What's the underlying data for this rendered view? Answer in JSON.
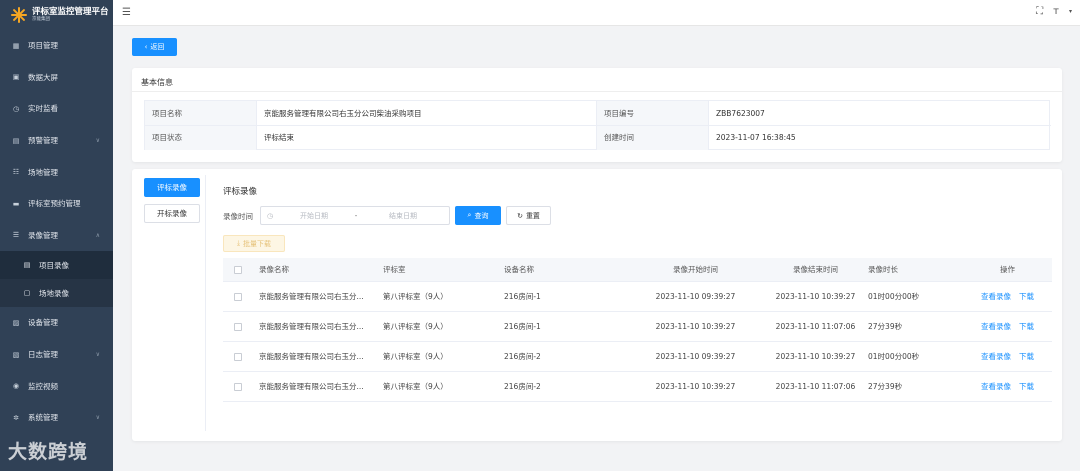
{
  "app": {
    "title": "评标室监控管理平台",
    "subtitle": "京能集团"
  },
  "sidebar": {
    "items": [
      {
        "label": "项目管理",
        "icon": "grid-icon",
        "has_children": false
      },
      {
        "label": "数据大屏",
        "icon": "screen-icon",
        "has_children": false
      },
      {
        "label": "实时监看",
        "icon": "clock-icon",
        "has_children": false
      },
      {
        "label": "预警管理",
        "icon": "alert-icon",
        "has_children": true
      },
      {
        "label": "场地管理",
        "icon": "venue-icon",
        "has_children": false
      },
      {
        "label": "评标室预约管理",
        "icon": "calendar-icon",
        "has_children": false
      },
      {
        "label": "录像管理",
        "icon": "video-icon",
        "has_children": true,
        "expanded": true
      }
    ],
    "subitems": [
      {
        "label": "项目录像",
        "icon": "file-icon",
        "active": true
      },
      {
        "label": "场地录像",
        "icon": "file-icon",
        "active": false
      }
    ],
    "items_after": [
      {
        "label": "设备管理",
        "icon": "device-icon",
        "has_children": false
      },
      {
        "label": "日志管理",
        "icon": "log-icon",
        "has_children": true
      },
      {
        "label": "监控视频",
        "icon": "eye-icon",
        "has_children": false
      },
      {
        "label": "系统管理",
        "icon": "gear-icon",
        "has_children": true
      }
    ]
  },
  "toolbar": {
    "back_label": "返回"
  },
  "basic_info": {
    "title": "基本信息",
    "project_name_label": "项目名称",
    "project_name": "京能服务管理有限公司右玉分公司柴油采购项目",
    "project_no_label": "项目编号",
    "project_no": "ZBB7623007",
    "project_status_label": "项目状态",
    "project_status": "评标结束",
    "created_label": "创建时间",
    "created": "2023-11-07 16:38:45"
  },
  "recordings": {
    "tabs": [
      "评标录像",
      "开标录像"
    ],
    "active_tab": 0,
    "title": "评标录像",
    "filter_label": "录像时间",
    "start_placeholder": "开始日期",
    "range_separator": "-",
    "end_placeholder": "结束日期",
    "search_label": "查询",
    "reset_label": "重置",
    "batch_download_label": "批量下载",
    "columns": [
      "录像名称",
      "评标室",
      "设备名称",
      "录像开始时间",
      "录像结束时间",
      "录像时长",
      "操作"
    ],
    "view_label": "查看录像",
    "download_label": "下载",
    "rows": [
      {
        "name": "京能服务管理有限公司右玉分...",
        "room": "第八评标室（9人）",
        "device": "216房间-1",
        "start": "2023-11-10 09:39:27",
        "end": "2023-11-10 10:39:27",
        "duration": "01时00分00秒"
      },
      {
        "name": "京能服务管理有限公司右玉分...",
        "room": "第八评标室（9人）",
        "device": "216房间-1",
        "start": "2023-11-10 10:39:27",
        "end": "2023-11-10 11:07:06",
        "duration": "27分39秒"
      },
      {
        "name": "京能服务管理有限公司右玉分...",
        "room": "第八评标室（9人）",
        "device": "216房间-2",
        "start": "2023-11-10 09:39:27",
        "end": "2023-11-10 10:39:27",
        "duration": "01时00分00秒"
      },
      {
        "name": "京能服务管理有限公司右玉分...",
        "room": "第八评标室（9人）",
        "device": "216房间-2",
        "start": "2023-11-10 10:39:27",
        "end": "2023-11-10 11:07:06",
        "duration": "27分39秒"
      }
    ]
  },
  "watermark": "大数跨境",
  "colors": {
    "sidebar_bg": "#304156",
    "primary": "#1890ff",
    "warning_light": "#fdf6e4"
  }
}
